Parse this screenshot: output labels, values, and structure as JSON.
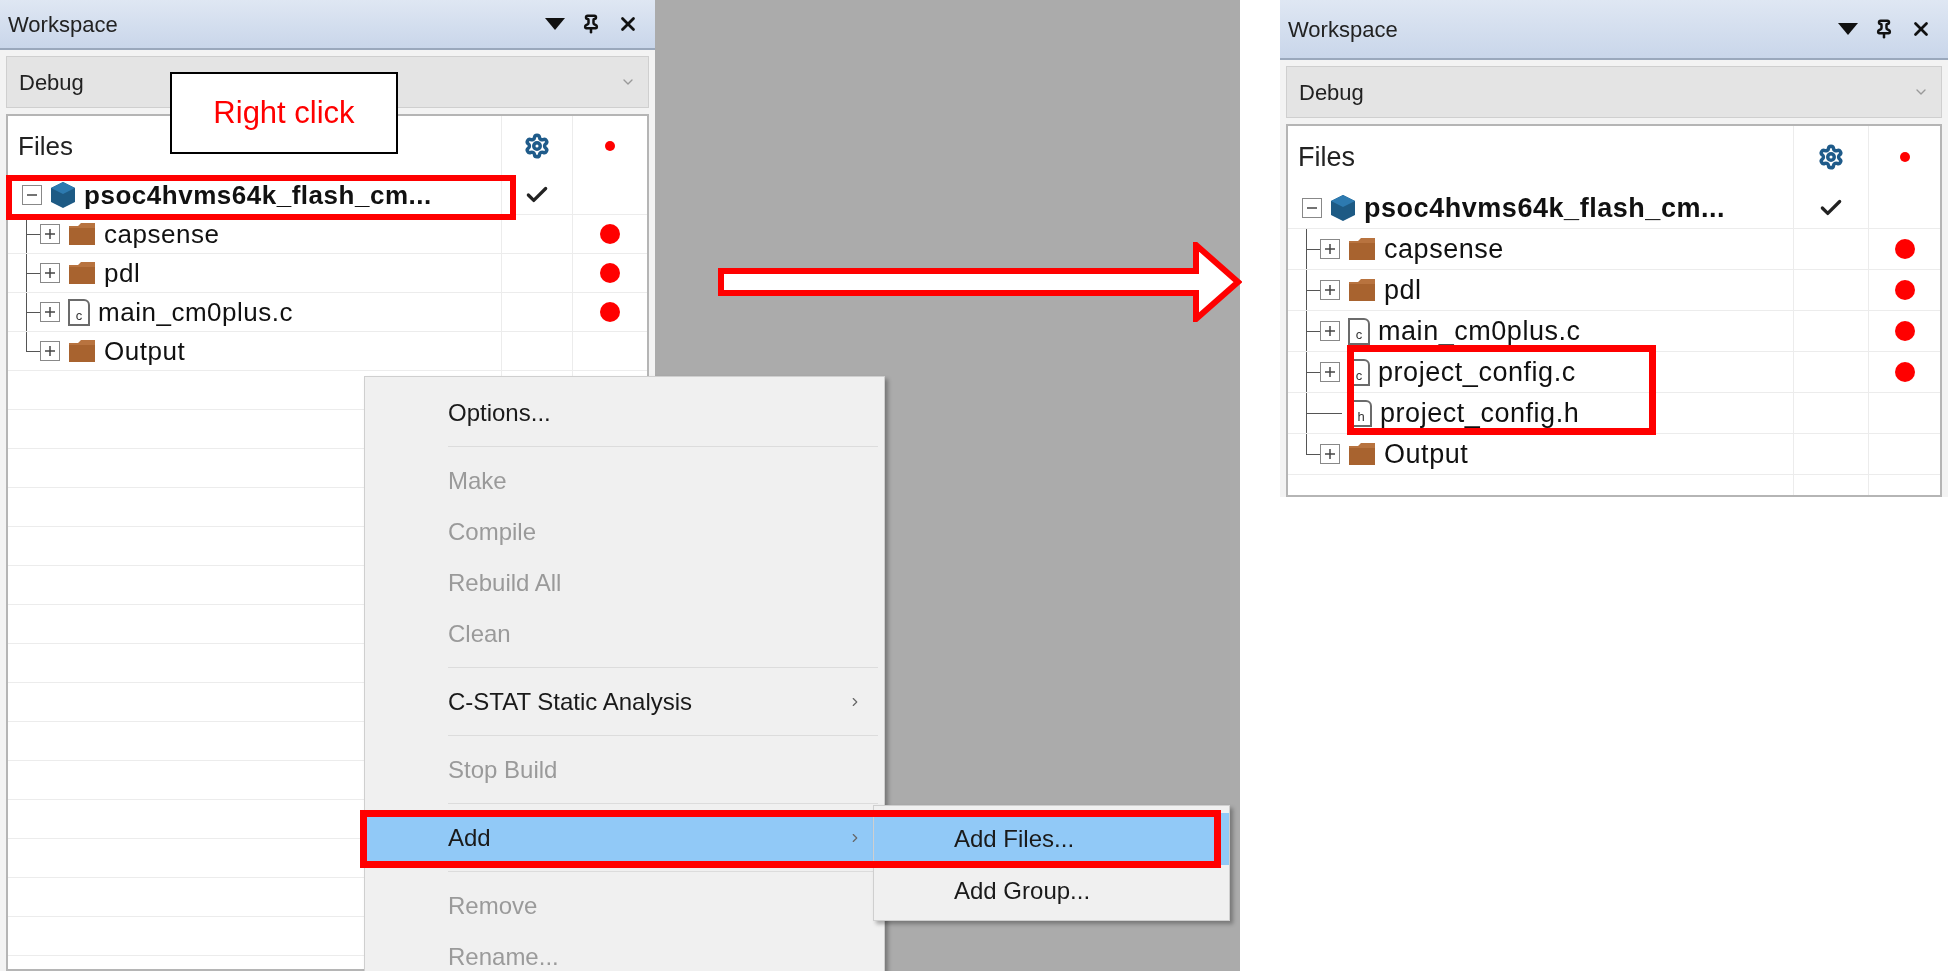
{
  "callout": {
    "text": "Right click"
  },
  "left_panel": {
    "title": "Workspace",
    "configuration": "Debug",
    "files_column": "Files",
    "tree": {
      "label": "psoc4hvms64k_flash_cm...",
      "kind": "project",
      "expandable": true,
      "expanded": true,
      "up_to_date": true,
      "modified": false,
      "children": [
        {
          "label": "capsense",
          "kind": "folder",
          "expandable": true,
          "expanded": false,
          "up_to_date": false,
          "modified": true
        },
        {
          "label": "pdl",
          "kind": "folder",
          "expandable": true,
          "expanded": false,
          "up_to_date": false,
          "modified": true
        },
        {
          "label": "main_cm0plus.c",
          "kind": "file",
          "icon_letter": "c",
          "expandable": true,
          "expanded": false,
          "up_to_date": false,
          "modified": true
        },
        {
          "label": "Output",
          "kind": "folder",
          "expandable": true,
          "expanded": false,
          "up_to_date": false,
          "modified": false
        }
      ]
    }
  },
  "context_menu": {
    "items": [
      {
        "label": "Options...",
        "disabled": false,
        "selected": false,
        "submenu": false,
        "separator_before": false
      },
      {
        "label": "Make",
        "disabled": true,
        "selected": false,
        "submenu": false,
        "separator_before": true
      },
      {
        "label": "Compile",
        "disabled": true,
        "selected": false,
        "submenu": false,
        "separator_before": false
      },
      {
        "label": "Rebuild All",
        "disabled": true,
        "selected": false,
        "submenu": false,
        "separator_before": false
      },
      {
        "label": "Clean",
        "disabled": true,
        "selected": false,
        "submenu": false,
        "separator_before": false
      },
      {
        "label": "C-STAT Static Analysis",
        "disabled": false,
        "selected": false,
        "submenu": true,
        "separator_before": true
      },
      {
        "label": "Stop Build",
        "disabled": true,
        "selected": false,
        "submenu": false,
        "separator_before": true
      },
      {
        "label": "Add",
        "disabled": false,
        "selected": true,
        "submenu": true,
        "separator_before": true
      },
      {
        "label": "Remove",
        "disabled": true,
        "selected": false,
        "submenu": false,
        "separator_before": true
      },
      {
        "label": "Rename...",
        "disabled": true,
        "selected": false,
        "submenu": false,
        "separator_before": false
      }
    ]
  },
  "submenu": {
    "items": [
      {
        "label": "Add Files...",
        "selected": true
      },
      {
        "label": "Add Group...",
        "selected": false
      }
    ]
  },
  "right_panel": {
    "title": "Workspace",
    "configuration": "Debug",
    "files_column": "Files",
    "tree": {
      "label": "psoc4hvms64k_flash_cm...",
      "kind": "project",
      "expandable": true,
      "expanded": true,
      "up_to_date": true,
      "modified": false,
      "children": [
        {
          "label": "capsense",
          "kind": "folder",
          "expandable": true,
          "expanded": false,
          "up_to_date": false,
          "modified": true
        },
        {
          "label": "pdl",
          "kind": "folder",
          "expandable": true,
          "expanded": false,
          "up_to_date": false,
          "modified": true
        },
        {
          "label": "main_cm0plus.c",
          "kind": "file",
          "icon_letter": "c",
          "expandable": true,
          "expanded": false,
          "up_to_date": false,
          "modified": true
        },
        {
          "label": "project_config.c",
          "kind": "file",
          "icon_letter": "c",
          "expandable": true,
          "expanded": false,
          "up_to_date": false,
          "modified": true
        },
        {
          "label": "project_config.h",
          "kind": "file",
          "icon_letter": "h",
          "expandable": false,
          "up_to_date": false,
          "modified": false
        },
        {
          "label": "Output",
          "kind": "folder",
          "expandable": true,
          "expanded": false,
          "up_to_date": false,
          "modified": false
        }
      ]
    }
  }
}
